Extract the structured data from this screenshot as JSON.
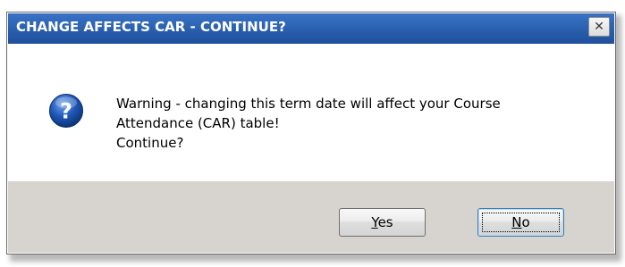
{
  "dialog": {
    "title": "CHANGE AFFECTS CAR - CONTINUE?",
    "close_glyph": "✕",
    "icon": "question-icon",
    "icon_glyph": "?",
    "message_lines": [
      "Warning - changing this term date will affect your Course",
      "Attendance (CAR) table!",
      "Continue?"
    ],
    "buttons": {
      "yes": {
        "mnemonic": "Y",
        "rest": "es"
      },
      "no": {
        "mnemonic": "N",
        "rest": "o"
      }
    }
  },
  "colors": {
    "titlebar": "#2a5fae",
    "footer": "#d7d4cf",
    "icon_blue": "#1f57b8"
  }
}
